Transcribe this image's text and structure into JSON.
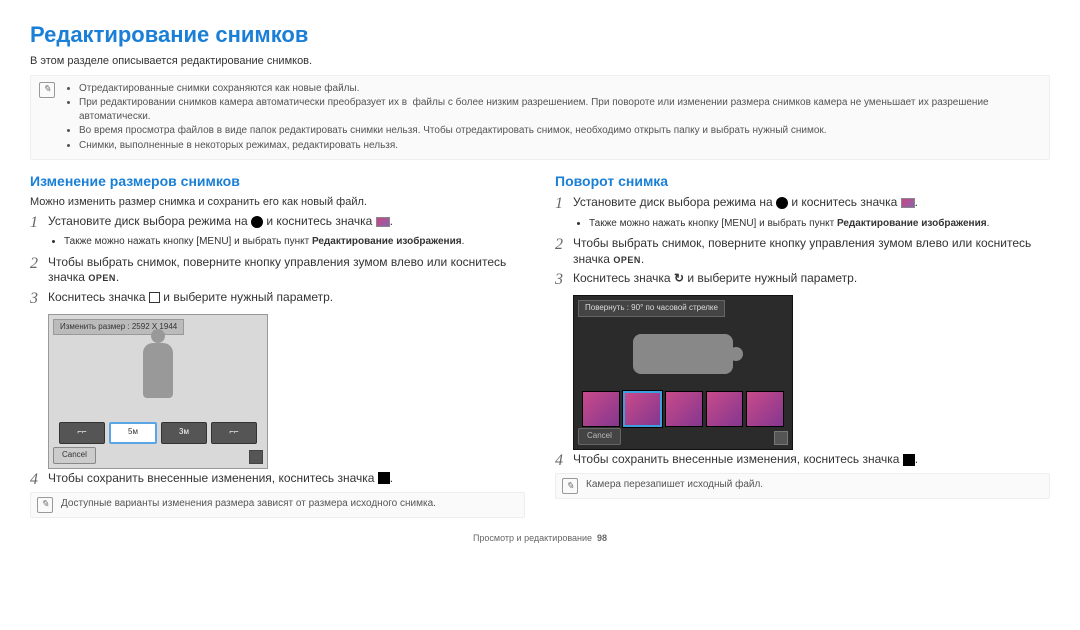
{
  "title": "Редактирование снимков",
  "intro": "В этом разделе описывается редактирование снимков.",
  "info_bullets": [
    "Отредактированные снимки сохраняются как новые файлы.",
    "При редактировании снимков камера автоматически преобразует их в  файлы с более низким разрешением. При повороте или изменении размера снимков камера не уменьшает их разрешение автоматически.",
    "Во время просмотра файлов в виде папок редактировать снимки нельзя. Чтобы отредактировать снимок, необходимо открыть папку и выбрать нужный снимок.",
    "Снимки, выполненные в некоторых режимах, редактировать нельзя."
  ],
  "left": {
    "title": "Изменение размеров снимков",
    "sub": "Можно изменить размер снимка и сохранить его как новый файл.",
    "step1": "Установите диск выбора режима на ",
    "step1b": " и коснитесь значка ",
    "step1_sub": "Также можно нажать кнопку [MENU] и выбрать пункт ",
    "step1_sub_bold": "Редактирование изображения",
    "step2": "Чтобы выбрать снимок, поверните кнопку управления зумом влево или коснитесь значка ",
    "open": "OPEN",
    "step3a": "Коснитесь значка ",
    "step3b": " и выберите нужный параметр.",
    "screen_label": "Изменить размер : 2592 X 1944",
    "screen_cancel": "Cancel",
    "size_buttons": [
      "⌐⌐",
      "5м",
      "3м",
      "⌐⌐"
    ],
    "step4": "Чтобы сохранить внесенные изменения, коснитесь значка ",
    "note": "Доступные варианты изменения размера зависят от размера исходного снимка."
  },
  "right": {
    "title": "Поворот снимка",
    "step1": "Установите диск выбора режима на ",
    "step1b": " и коснитесь значка ",
    "step1_sub": "Также можно нажать кнопку [MENU] и выбрать пункт ",
    "step1_sub_bold": "Редактирование изображения",
    "step2": "Чтобы выбрать снимок, поверните кнопку управления зумом влево или коснитесь значка ",
    "open": "OPEN",
    "step3a": "Коснитесь значка ",
    "step3b": " и выберите нужный параметр.",
    "screen_label": "Повернуть : 90° по часовой стрелке",
    "screen_cancel": "Cancel",
    "step4": "Чтобы сохранить внесенные изменения, коснитесь значка ",
    "note": "Камера перезапишет исходный файл."
  },
  "footer": "Просмотр и редактирование",
  "page_num": "98",
  "menu_label": "MENU",
  "info_glyph": "✎"
}
